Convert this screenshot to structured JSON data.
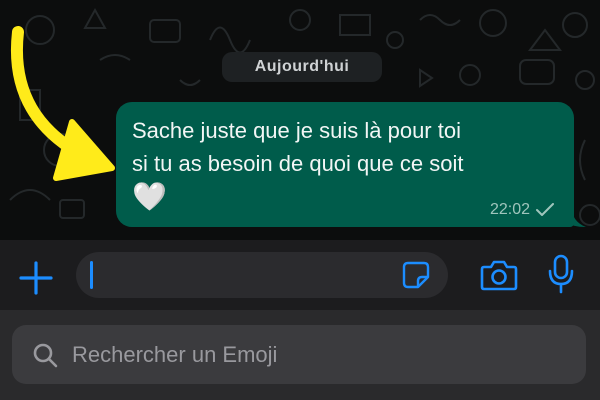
{
  "chat": {
    "date_label": "Aujourd'hui",
    "message": {
      "line1": "Sache juste que je suis là pour toi",
      "line2": "si tu as besoin de quoi que ce soit",
      "emoji": "🤍",
      "time": "22:02",
      "status_icon": "single-check-icon"
    }
  },
  "composer": {
    "plus_icon": "plus-icon",
    "input_value": "",
    "sticker_icon": "sticker-icon",
    "camera_icon": "camera-icon",
    "mic_icon": "microphone-icon"
  },
  "emoji_search": {
    "icon": "search-icon",
    "placeholder": "Rechercher un Emoji"
  },
  "colors": {
    "bubble": "#005c4b",
    "accent": "#1c8dff",
    "arrow": "#ffeb1a"
  }
}
